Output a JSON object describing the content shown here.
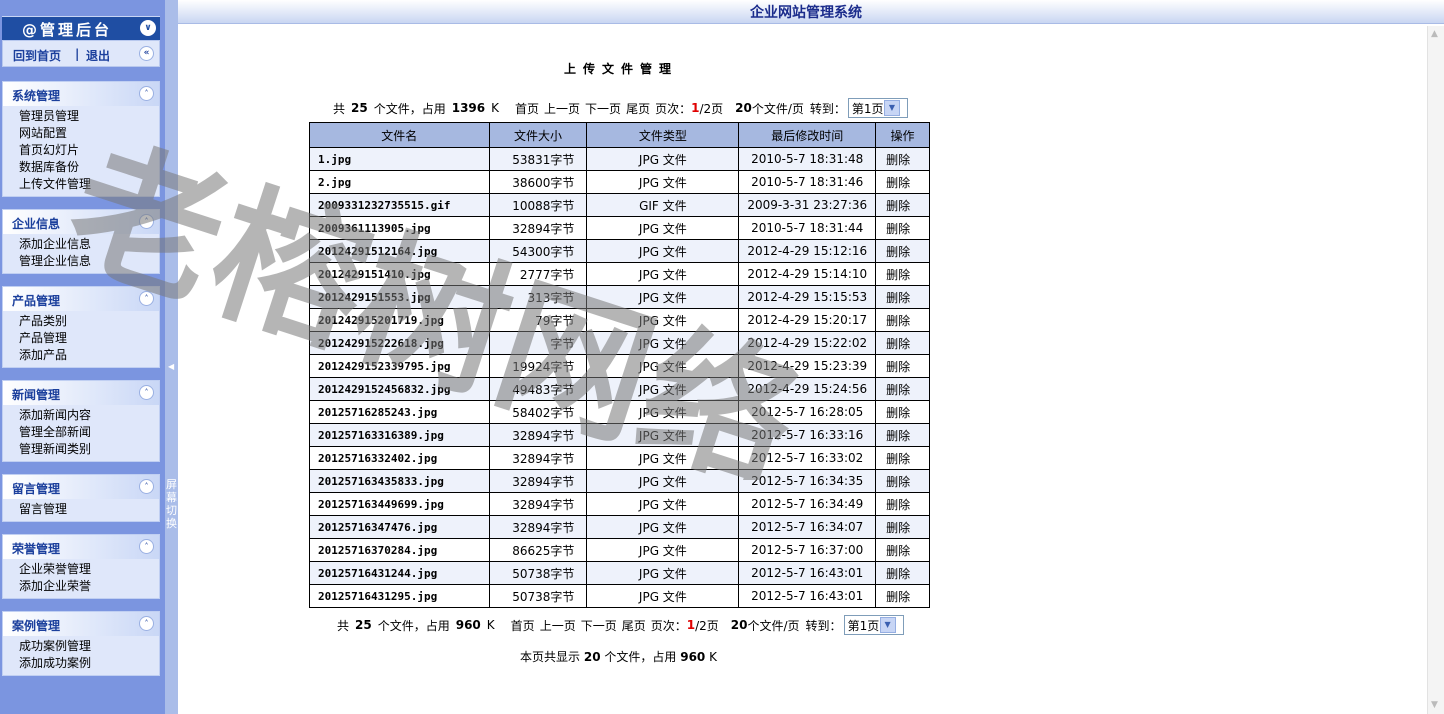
{
  "sidebar": {
    "brand_title": "@管理后台",
    "home_label": "回到首页",
    "separator": "|",
    "logout_label": "退出",
    "switch_label": "屏幕切换",
    "groups": [
      {
        "title": "系统管理",
        "items": [
          "管理员管理",
          "网站配置",
          "首页幻灯片",
          "数据库备份",
          "上传文件管理"
        ]
      },
      {
        "title": "企业信息",
        "items": [
          "添加企业信息",
          "管理企业信息"
        ]
      },
      {
        "title": "产品管理",
        "items": [
          "产品类别",
          "产品管理",
          "添加产品"
        ]
      },
      {
        "title": "新闻管理",
        "items": [
          "添加新闻内容",
          "管理全部新闻",
          "管理新闻类别"
        ]
      },
      {
        "title": "留言管理",
        "items": [
          "留言管理"
        ]
      },
      {
        "title": "荣誉管理",
        "items": [
          "企业荣誉管理",
          "添加企业荣誉"
        ]
      },
      {
        "title": "案例管理",
        "items": [
          "成功案例管理",
          "添加成功案例"
        ]
      }
    ]
  },
  "header": {
    "system_title": "企业网站管理系统"
  },
  "main": {
    "page_title": "上传文件管理",
    "pager_top": {
      "total_prefix": "共",
      "total_files": "25",
      "files_mid": "个文件，占用",
      "total_size": "1396",
      "size_unit": "K",
      "first": "首页",
      "prev": "上一页",
      "next": "下一页",
      "last": "尾页",
      "page_label": "页次：",
      "page_current": "1",
      "page_total": "/2页",
      "per_page_count": "20",
      "per_page_unit": "个文件/页",
      "goto_label": "转到：",
      "select_value": "第1页"
    },
    "pager_bottom": {
      "total_prefix": "共",
      "total_files": "25",
      "files_mid": "个文件，占用",
      "total_size": "960",
      "size_unit": "K",
      "first": "首页",
      "prev": "上一页",
      "next": "下一页",
      "last": "尾页",
      "page_label": "页次：",
      "page_current": "1",
      "page_total": "/2页",
      "per_page_count": "20",
      "per_page_unit": "个文件/页",
      "goto_label": "转到：",
      "select_value": "第1页"
    },
    "table": {
      "headers": [
        "文件名",
        "文件大小",
        "文件类型",
        "最后修改时间",
        "操作"
      ],
      "rows": [
        [
          "1.jpg",
          "53831字节",
          "JPG 文件",
          "2010-5-7 18:31:48",
          "删除"
        ],
        [
          "2.jpg",
          "38600字节",
          "JPG 文件",
          "2010-5-7 18:31:46",
          "删除"
        ],
        [
          "2009331232735515.gif",
          "10088字节",
          "GIF 文件",
          "2009-3-31 23:27:36",
          "删除"
        ],
        [
          "2009361113905.jpg",
          "32894字节",
          "JPG 文件",
          "2010-5-7 18:31:44",
          "删除"
        ],
        [
          "20124291512164.jpg",
          "54300字节",
          "JPG 文件",
          "2012-4-29 15:12:16",
          "删除"
        ],
        [
          "2012429151410.jpg",
          "2777字节",
          "JPG 文件",
          "2012-4-29 15:14:10",
          "删除"
        ],
        [
          "2012429151553.jpg",
          "313字节",
          "JPG 文件",
          "2012-4-29 15:15:53",
          "删除"
        ],
        [
          "201242915201719.jpg",
          "79字节",
          "JPG 文件",
          "2012-4-29 15:20:17",
          "删除"
        ],
        [
          "201242915222618.jpg",
          "字节",
          "JPG 文件",
          "2012-4-29 15:22:02",
          "删除"
        ],
        [
          "2012429152339795.jpg",
          "19924字节",
          "JPG 文件",
          "2012-4-29 15:23:39",
          "删除"
        ],
        [
          "2012429152456832.jpg",
          "49483字节",
          "JPG 文件",
          "2012-4-29 15:24:56",
          "删除"
        ],
        [
          "20125716285243.jpg",
          "58402字节",
          "JPG 文件",
          "2012-5-7 16:28:05",
          "删除"
        ],
        [
          "20125716331638​9.jpg",
          "32894字节",
          "JPG 文件",
          "2012-5-7 16:33:16",
          "删除"
        ],
        [
          "20125716332402.jpg",
          "32894字节",
          "JPG 文件",
          "2012-5-7 16:33:02",
          "删除"
        ],
        [
          "201257163435833.jpg",
          "32894字节",
          "JPG 文件",
          "2012-5-7 16:34:35",
          "删除"
        ],
        [
          "201257163449699.jpg",
          "32894字节",
          "JPG 文件",
          "2012-5-7 16:34:49",
          "删除"
        ],
        [
          "20125716347476.jpg",
          "32894字节",
          "JPG 文件",
          "2012-5-7 16:34:07",
          "删除"
        ],
        [
          "20125716370284.jpg",
          "86625字节",
          "JPG 文件",
          "2012-5-7 16:37:00",
          "删除"
        ],
        [
          "20125716431244.jpg",
          "50738字节",
          "JPG 文件",
          "2012-5-7 16:43:01",
          "删除"
        ],
        [
          "20125716431295.jpg",
          "50738字节",
          "JPG 文件",
          "2012-5-7 16:43:01",
          "删除"
        ]
      ]
    },
    "summary": {
      "prefix": "本页共显示",
      "count": "20",
      "mid": "个文件，占用",
      "size": "960",
      "unit": "K"
    }
  },
  "watermark": {
    "text": "老榕树网络"
  },
  "colors": {
    "sidebar_bg": "#7b95e0",
    "brand_bg": "#1f4ea3",
    "table_header": "#a6b8e0",
    "link_blue": "#1b3f9c",
    "page_red": "#e00000"
  },
  "icons": {
    "collapse": "double-chevron-up-icon",
    "brand_collapse": "double-chevron-down-icon",
    "home_collapse": "double-chevron-left-icon"
  }
}
